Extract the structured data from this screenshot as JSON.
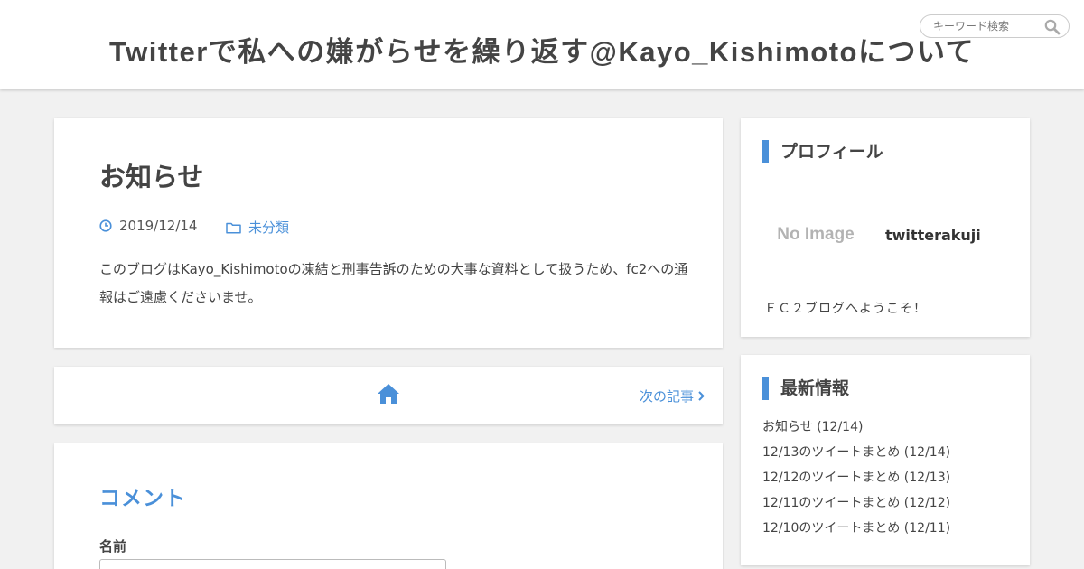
{
  "header": {
    "site_title": "Twitterで私への嫌がらせを繰り返す@Kayo_Kishimotoについて",
    "search_placeholder": "キーワード検索",
    "search_icon": "search-icon"
  },
  "article": {
    "title": "お知らせ",
    "date": "2019/12/14",
    "category": "未分類",
    "body": "このブログはKayo_Kishimotoの凍結と刑事告訴のための大事な資料として扱うため、fc2への通報はご遠慮くださいませ。"
  },
  "nav": {
    "home_icon": "home-icon",
    "next_label": "次の記事"
  },
  "comment": {
    "heading": "コメント",
    "name_label": "名前",
    "name_value": ""
  },
  "sidebar": {
    "profile": {
      "title": "プロフィール",
      "image_text": "No Image",
      "name": "twitterakuji",
      "description": "ＦＣ２ブログへようこそ！"
    },
    "recent": {
      "title": "最新情報",
      "items": [
        {
          "label": "お知らせ (12/14)"
        },
        {
          "label": "12/13のツイートまとめ (12/14)"
        },
        {
          "label": "12/12のツイートまとめ (12/13)"
        },
        {
          "label": "12/11のツイートまとめ (12/12)"
        },
        {
          "label": "12/10のツイートまとめ (12/11)"
        }
      ]
    }
  },
  "colors": {
    "accent": "#4a90d9",
    "background": "#f1f1f1",
    "title_text": "#444444"
  }
}
